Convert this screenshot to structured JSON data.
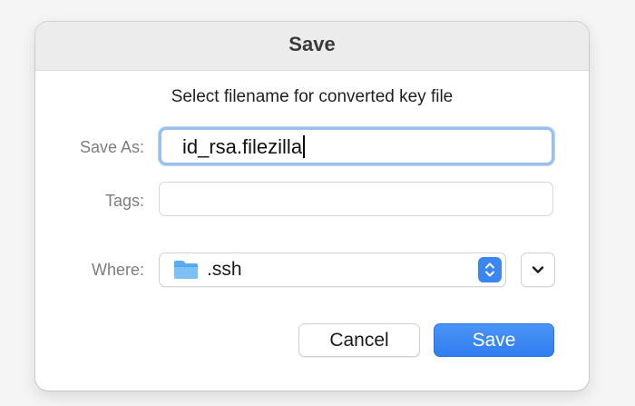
{
  "dialog": {
    "title": "Save",
    "message": "Select filename for converted key file",
    "save_as": {
      "label": "Save As:",
      "value": "id_rsa.filezilla"
    },
    "tags": {
      "label": "Tags:",
      "value": ""
    },
    "where": {
      "label": "Where:",
      "selected": ".ssh",
      "icon": "folder-icon"
    },
    "buttons": {
      "cancel_label": "Cancel",
      "save_label": "Save"
    }
  },
  "colors": {
    "accent": "#3b86f1",
    "focus_ring": "#9cc0ee",
    "folder": "#5aaef0",
    "label_gray": "#7d7d7d"
  }
}
